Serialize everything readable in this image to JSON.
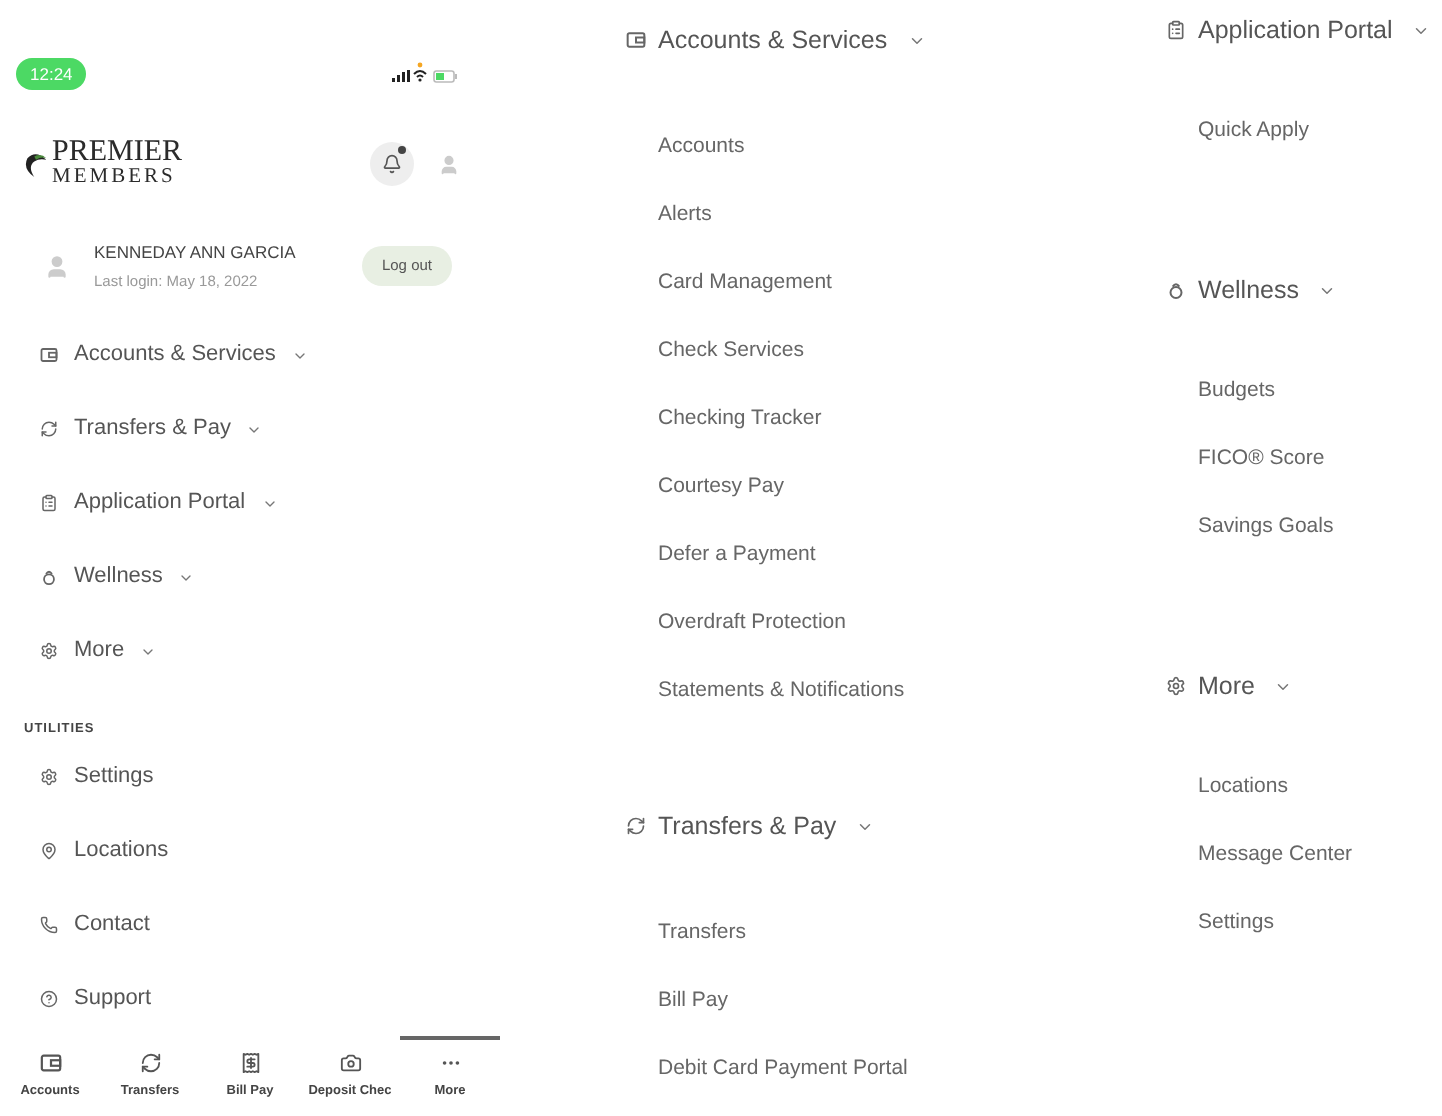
{
  "status_bar": {
    "time": "12:24"
  },
  "brand": {
    "line_1": "PREMIER",
    "line_2": "MEMBERS"
  },
  "notifications": {
    "unread": true
  },
  "user": {
    "name": "KENNEDAY ANN GARCIA",
    "last_login": "Last login: May 18, 2022",
    "logout": "Log out"
  },
  "menu": [
    {
      "kind": "accounts",
      "label": "Accounts & Services"
    },
    {
      "kind": "transfers",
      "label": "Transfers & Pay"
    },
    {
      "kind": "applications",
      "label": "Application Portal"
    },
    {
      "kind": "wellness",
      "label": "Wellness"
    },
    {
      "kind": "more",
      "label": "More"
    }
  ],
  "utilities": {
    "heading": "UTILITIES",
    "items": [
      {
        "kind": "settings",
        "label": "Settings"
      },
      {
        "kind": "locations",
        "label": "Locations"
      },
      {
        "kind": "contact",
        "label": "Contact"
      },
      {
        "kind": "support",
        "label": "Support"
      }
    ]
  },
  "tab_bar": [
    {
      "kind": "accounts",
      "label": "Accounts",
      "selected": false
    },
    {
      "kind": "transfers",
      "label": "Transfers",
      "selected": false
    },
    {
      "kind": "billpay",
      "label": "Bill Pay",
      "selected": false
    },
    {
      "kind": "deposit",
      "label": "Deposit Chec",
      "selected": false
    },
    {
      "kind": "more",
      "label": "More",
      "selected": true
    }
  ],
  "column_2": [
    {
      "kind": "accounts",
      "label": "Accounts & Services",
      "items": [
        "Accounts",
        "Alerts",
        "Card Management",
        "Check Services",
        "Checking Tracker",
        "Courtesy Pay",
        "Defer a Payment",
        "Overdraft Protection",
        "Statements & Notifications"
      ]
    },
    {
      "kind": "transfers",
      "label": "Transfers & Pay",
      "items": [
        "Transfers",
        "Bill Pay",
        "Debit Card Payment Portal"
      ]
    }
  ],
  "column_3": [
    {
      "kind": "applications",
      "label": "Application Portal",
      "items": [
        "Quick Apply"
      ]
    },
    {
      "kind": "wellness",
      "label": "Wellness",
      "items": [
        "Budgets",
        "FICO® Score",
        "Savings Goals"
      ]
    },
    {
      "kind": "more",
      "label": "More",
      "items": [
        "Locations",
        "Message Center",
        "Settings"
      ]
    }
  ]
}
